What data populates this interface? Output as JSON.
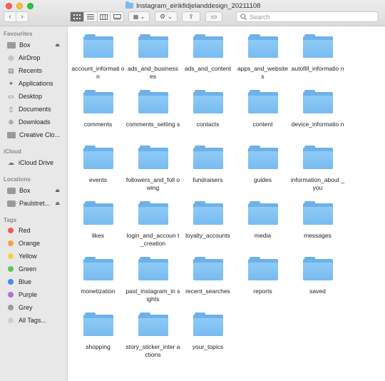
{
  "window": {
    "title": "Instagram_eirikfidjelanddesign_20211108"
  },
  "toolbar": {
    "back_glyph": "‹",
    "forward_glyph": "›",
    "view_icons": [
      "icon-view",
      "list-view",
      "column-view",
      "gallery-view"
    ],
    "group_glyph": "▦ ⌄",
    "action_glyph": "⚙ ⌄",
    "share_glyph": "⇪",
    "tag_glyph": "▭"
  },
  "search": {
    "placeholder": "Search"
  },
  "sidebar": {
    "favourites_title": "Favourites",
    "favourites": [
      {
        "label": "Box",
        "icon": "folder-icon"
      },
      {
        "label": "AirDrop",
        "icon": "airdrop-icon"
      },
      {
        "label": "Recents",
        "icon": "recents-icon"
      },
      {
        "label": "Applications",
        "icon": "applications-icon"
      },
      {
        "label": "Desktop",
        "icon": "desktop-icon"
      },
      {
        "label": "Documents",
        "icon": "documents-icon"
      },
      {
        "label": "Downloads",
        "icon": "downloads-icon"
      },
      {
        "label": "Creative Clo...",
        "icon": "folder-icon"
      }
    ],
    "icloud_title": "iCloud",
    "icloud": [
      {
        "label": "iCloud Drive",
        "icon": "cloud-icon"
      }
    ],
    "locations_title": "Locations",
    "locations": [
      {
        "label": "Box",
        "icon": "disk-icon"
      },
      {
        "label": "Paulstret...",
        "icon": "disk-icon"
      }
    ],
    "tags_title": "Tags",
    "tags": [
      {
        "label": "Red",
        "color": "#f25a51"
      },
      {
        "label": "Orange",
        "color": "#f7a23b"
      },
      {
        "label": "Yellow",
        "color": "#f7d33b"
      },
      {
        "label": "Green",
        "color": "#5bc75a"
      },
      {
        "label": "Blue",
        "color": "#3d8ef0"
      },
      {
        "label": "Purple",
        "color": "#b66fd8"
      },
      {
        "label": "Grey",
        "color": "#9a9a9a"
      },
      {
        "label": "All Tags...",
        "color": "#cfcfcf"
      }
    ],
    "eject_glyph": "⏏"
  },
  "files": [
    {
      "name": "account_informati on"
    },
    {
      "name": "ads_and_business es"
    },
    {
      "name": "ads_and_content"
    },
    {
      "name": "apps_and_website s"
    },
    {
      "name": "autofill_informatio n"
    },
    {
      "name": "comments"
    },
    {
      "name": "comments_setting s"
    },
    {
      "name": "contacts"
    },
    {
      "name": "content"
    },
    {
      "name": "device_informatio n"
    },
    {
      "name": "events"
    },
    {
      "name": "followers_and_foll owing"
    },
    {
      "name": "fundraisers"
    },
    {
      "name": "guides"
    },
    {
      "name": "information_about _you"
    },
    {
      "name": "likes"
    },
    {
      "name": "login_and_accoun t_creation"
    },
    {
      "name": "loyalty_accounts"
    },
    {
      "name": "media"
    },
    {
      "name": "messages"
    },
    {
      "name": "monetization"
    },
    {
      "name": "past_instagram_in sights"
    },
    {
      "name": "recent_searches"
    },
    {
      "name": "reports"
    },
    {
      "name": "saved"
    },
    {
      "name": "shopping"
    },
    {
      "name": "story_sticker_inter actions"
    },
    {
      "name": "your_topics"
    }
  ]
}
